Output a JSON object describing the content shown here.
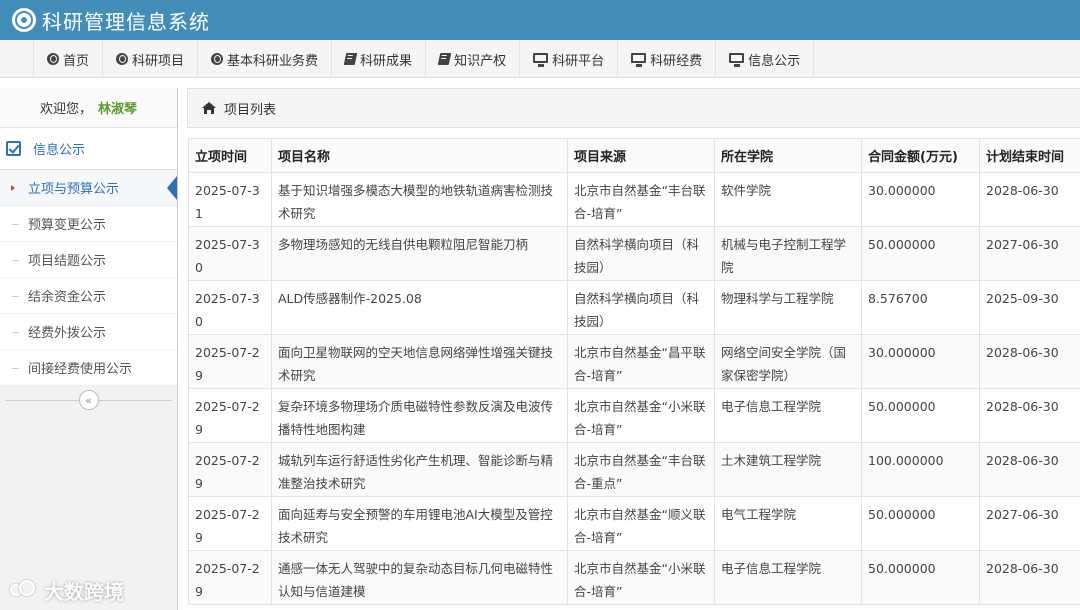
{
  "app": {
    "title": "科研管理信息系统"
  },
  "nav": [
    {
      "label": "首页",
      "icon": "globe-icon"
    },
    {
      "label": "科研项目",
      "icon": "globe-icon"
    },
    {
      "label": "基本科研业务费",
      "icon": "globe-icon"
    },
    {
      "label": "科研成果",
      "icon": "book-icon"
    },
    {
      "label": "知识产权",
      "icon": "book-icon"
    },
    {
      "label": "科研平台",
      "icon": "desktop-icon"
    },
    {
      "label": "科研经费",
      "icon": "desktop-icon"
    },
    {
      "label": "信息公示",
      "icon": "desktop-icon"
    }
  ],
  "sidebar": {
    "welcome": "欢迎您，",
    "username": "林淑琴",
    "section": "信息公示",
    "items": [
      {
        "label": "立项与预算公示",
        "active": true
      },
      {
        "label": "预算变更公示"
      },
      {
        "label": "项目结题公示"
      },
      {
        "label": "结余资金公示"
      },
      {
        "label": "经费外拨公示"
      },
      {
        "label": "间接经费使用公示"
      }
    ],
    "collapse": "«"
  },
  "breadcrumb": {
    "label": "项目列表"
  },
  "table": {
    "headers": [
      "立项时间",
      "项目名称",
      "项目来源",
      "所在学院",
      "合同金额(万元)",
      "计划结束时间"
    ],
    "rows": [
      [
        "2025-07-31",
        "基于知识增强多模态大模型的地铁轨道病害检测技术研究",
        "北京市自然基金“丰台联合-培育”",
        "软件学院",
        "30.000000",
        "2028-06-30"
      ],
      [
        "2025-07-30",
        "多物理场感知的无线自供电颗粒阻尼智能刀柄",
        "自然科学横向项目（科技园）",
        "机械与电子控制工程学院",
        "50.000000",
        "2027-06-30"
      ],
      [
        "2025-07-30",
        "ALD传感器制作-2025.08",
        "自然科学横向项目（科技园）",
        "物理科学与工程学院",
        "8.576700",
        "2025-09-30"
      ],
      [
        "2025-07-29",
        "面向卫星物联网的空天地信息网络弹性增强关键技术研究",
        "北京市自然基金“昌平联合-培育”",
        "网络空间安全学院（国家保密学院）",
        "30.000000",
        "2028-06-30"
      ],
      [
        "2025-07-29",
        "复杂环境多物理场介质电磁特性参数反演及电波传播特性地图构建",
        "北京市自然基金“小米联合-培育”",
        "电子信息工程学院",
        "50.000000",
        "2028-06-30"
      ],
      [
        "2025-07-29",
        "城轨列车运行舒适性劣化产生机理、智能诊断与精准整治技术研究",
        "北京市自然基金“丰台联合-重点”",
        "土木建筑工程学院",
        "100.000000",
        "2028-06-30"
      ],
      [
        "2025-07-29",
        "面向延寿与安全预警的车用锂电池AI大模型及管控技术研究",
        "北京市自然基金“顺义联合-培育”",
        "电气工程学院",
        "50.000000",
        "2027-06-30"
      ],
      [
        "2025-07-29",
        "通感一体无人驾驶中的复杂动态目标几何电磁特性认知与信道建模",
        "北京市自然基金“小米联合-培育”",
        "电子信息工程学院",
        "50.000000",
        "2028-06-30"
      ]
    ]
  },
  "watermark": "大数跨境",
  "colors": {
    "header": "#438eb9",
    "accent": "#2f6fb5",
    "username": "#5b9b2c"
  }
}
